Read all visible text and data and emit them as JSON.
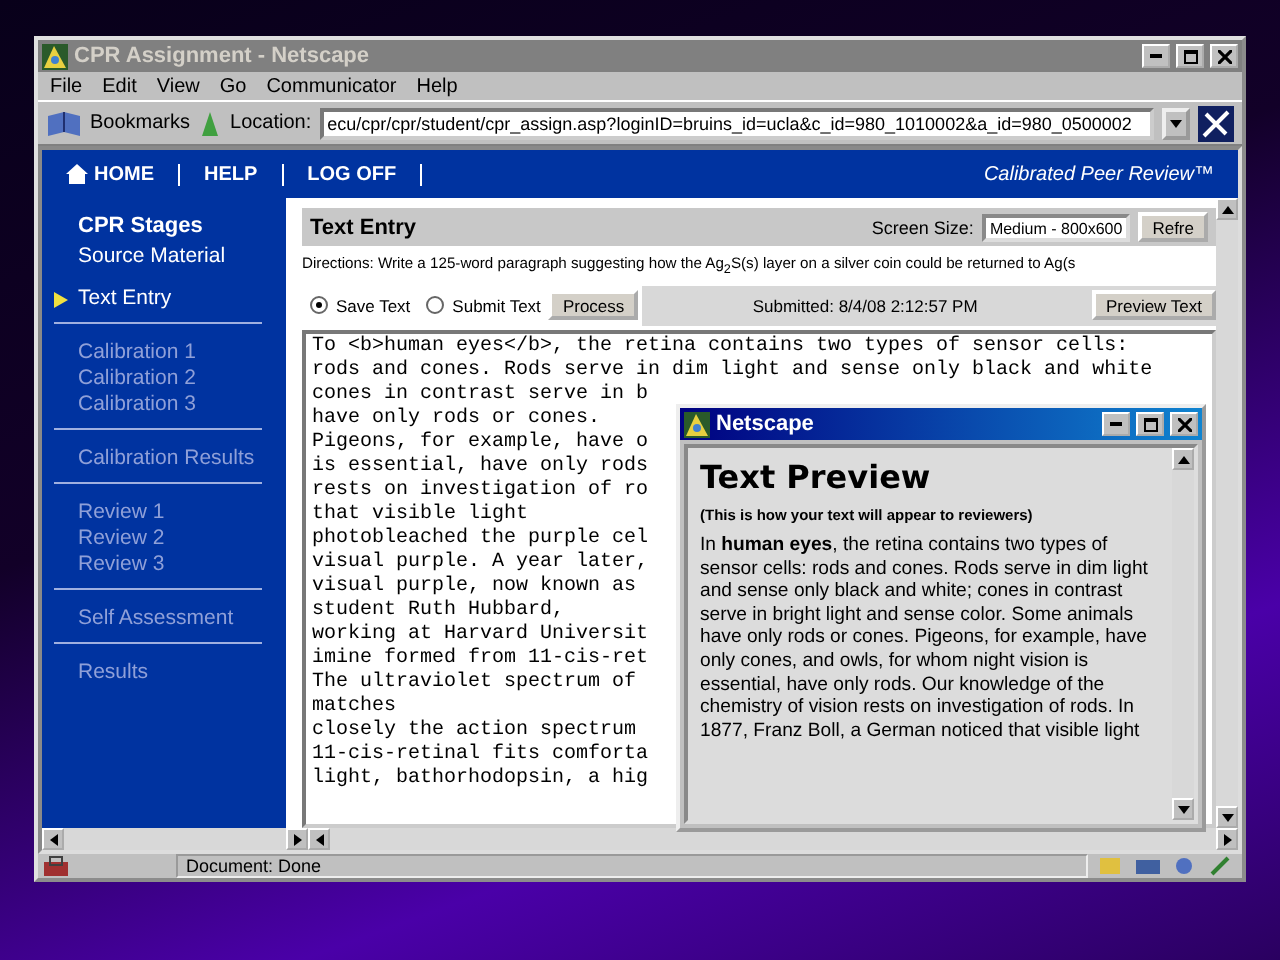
{
  "window": {
    "title": "CPR Assignment - Netscape"
  },
  "menu": [
    "File",
    "Edit",
    "View",
    "Go",
    "Communicator",
    "Help"
  ],
  "toolbar": {
    "bookmarks": "Bookmarks",
    "location_label": "Location:",
    "url": "ecu/cpr/cpr/student/cpr_assign.asp?loginID=bruins_id=ucla&c_id=980_1010002&a_id=980_0500002"
  },
  "nav": {
    "links": [
      "HOME",
      "HELP",
      "LOG OFF"
    ],
    "brand": "Calibrated Peer Review™"
  },
  "sidebar": {
    "heading": "CPR Stages",
    "groups": [
      [
        {
          "label": "Source Material",
          "selected": false,
          "disabled": false
        },
        {
          "label": "Text Entry",
          "selected": true,
          "disabled": false
        }
      ],
      [
        {
          "label": "Calibration 1",
          "selected": false,
          "disabled": true
        },
        {
          "label": "Calibration 2",
          "selected": false,
          "disabled": true
        },
        {
          "label": "Calibration 3",
          "selected": false,
          "disabled": true
        }
      ],
      [
        {
          "label": "Calibration Results",
          "selected": false,
          "disabled": true
        }
      ],
      [
        {
          "label": "Review 1",
          "selected": false,
          "disabled": true
        },
        {
          "label": "Review 2",
          "selected": false,
          "disabled": true
        },
        {
          "label": "Review 3",
          "selected": false,
          "disabled": true
        }
      ],
      [
        {
          "label": "Self Assessment",
          "selected": false,
          "disabled": true
        }
      ],
      [
        {
          "label": "Results",
          "selected": false,
          "disabled": true
        }
      ]
    ]
  },
  "main": {
    "title": "Text Entry",
    "screen_size_label": "Screen Size:",
    "screen_size": "Medium - 800x600",
    "refresh": "Refre",
    "directions": "Directions: Write a 125-word paragraph suggesting how the Ag$_{2}$S(s) layer on a silver coin could be returned to Ag(s",
    "options": [
      {
        "label": "Save Text",
        "selected": true
      },
      {
        "label": "Submit Text",
        "selected": false
      }
    ],
    "process": "Process",
    "submitted": "Submitted: 8/4/08 2:12:57 PM",
    "preview_button": "Preview Text",
    "text_lines": [
      "To <b>human eyes</b>, the retina contains two types of sensor cells:",
      "rods and cones. Rods serve in dim light and sense only black and white",
      "cones in contrast serve in b",
      "have only rods or cones.",
      "Pigeons, for example, have o",
      "is essential, have only rods",
      "rests on investigation of ro",
      "that visible light",
      "photobleached the purple cel",
      "visual purple. A year later,",
      "visual purple, now known as",
      "student Ruth Hubbard,",
      "working at Harvard Universit",
      "imine formed from 11-cis-ret",
      "The ultraviolet spectrum of",
      "matches",
      "closely the action spectrum",
      "11-cis-retinal fits comforta",
      "light, bathorhodopsin, a hig"
    ]
  },
  "popup": {
    "title": "Netscape",
    "heading": "Text Preview",
    "note": "(This is how your text will appear to reviewers)",
    "body": "In **human eyes**, the retina contains two types of sensor cells: rods and cones. Rods serve in dim light and sense only black and white; cones in contrast serve in bright light and sense color. Some animals have only rods or cones. Pigeons, for example, have only cones, and owls, for whom night vision is essential, have only rods. Our knowledge of the chemistry of vision rests on investigation of rods. In 1877, Franz Boll, a German noticed that visible light"
  },
  "status_bar": {
    "text": "Document: Done"
  }
}
